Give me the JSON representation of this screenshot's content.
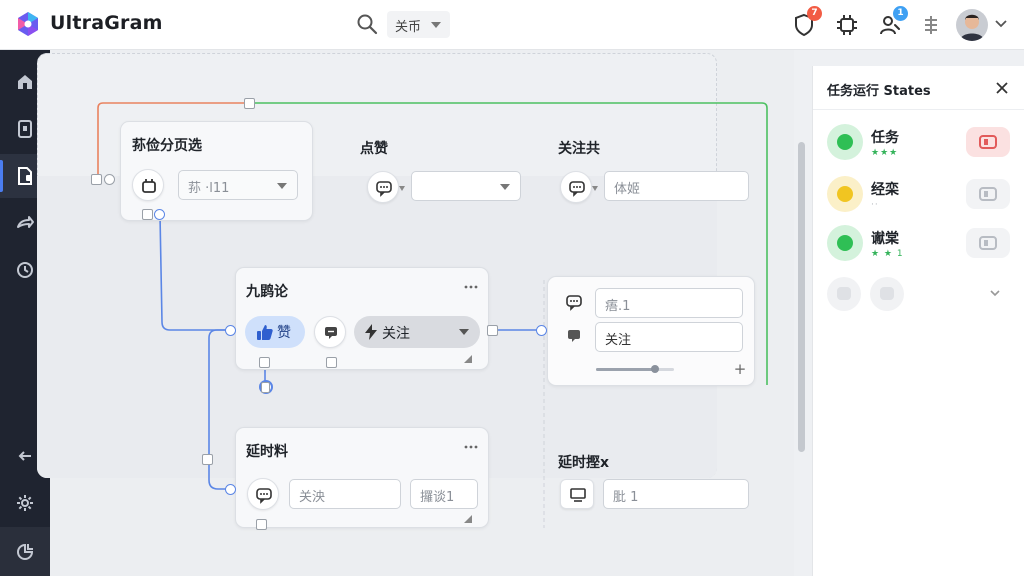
{
  "header": {
    "app_title": "UltraGram",
    "filter_select": "关币",
    "notifications_badge": "7",
    "support_badge": "1"
  },
  "nodes": {
    "start": {
      "title": "荪俭分页选",
      "field_value": "荪 ·l11"
    },
    "like": {
      "title": "点赞"
    },
    "follow": {
      "title": "关注共",
      "field_value": "体姬"
    },
    "comment": {
      "title": "九鹍论",
      "like_label": "赞",
      "follow_label": "关注"
    },
    "output": {
      "field1_value": "痦.1",
      "field2_value": "关注",
      "slider_fraction": 0.75
    },
    "delay": {
      "title": "延时料",
      "field1_value": "关泱",
      "field2_value": "攞谈1"
    },
    "delay2": {
      "title": "延时摼ⅹ",
      "field_value": "肶 1"
    }
  },
  "states_panel": {
    "title": "任务运行 States",
    "items": [
      {
        "label": "任务",
        "sub": "★★★",
        "color": "#2fbf55",
        "halo": "#d4f2dc",
        "action_bg": "#fbe1e1",
        "action_color": "#e25a5a"
      },
      {
        "label": "经栾",
        "sub": "··",
        "color": "#f1c521",
        "halo": "#fbf0c8",
        "action_bg": "#f2f3f5",
        "action_color": "#b8bcc3"
      },
      {
        "label": "谳棠",
        "sub": "★ ★ 1",
        "color": "#2fbf55",
        "halo": "#d4f2dc",
        "action_bg": "#f2f3f5",
        "action_color": "#b8bcc3"
      }
    ]
  },
  "colors": {
    "accent": "#4b7df0",
    "wire_blue": "#5b86e6",
    "wire_green": "#4cc061",
    "wire_orange": "#e9825f",
    "sidebar": "#1f2430"
  }
}
